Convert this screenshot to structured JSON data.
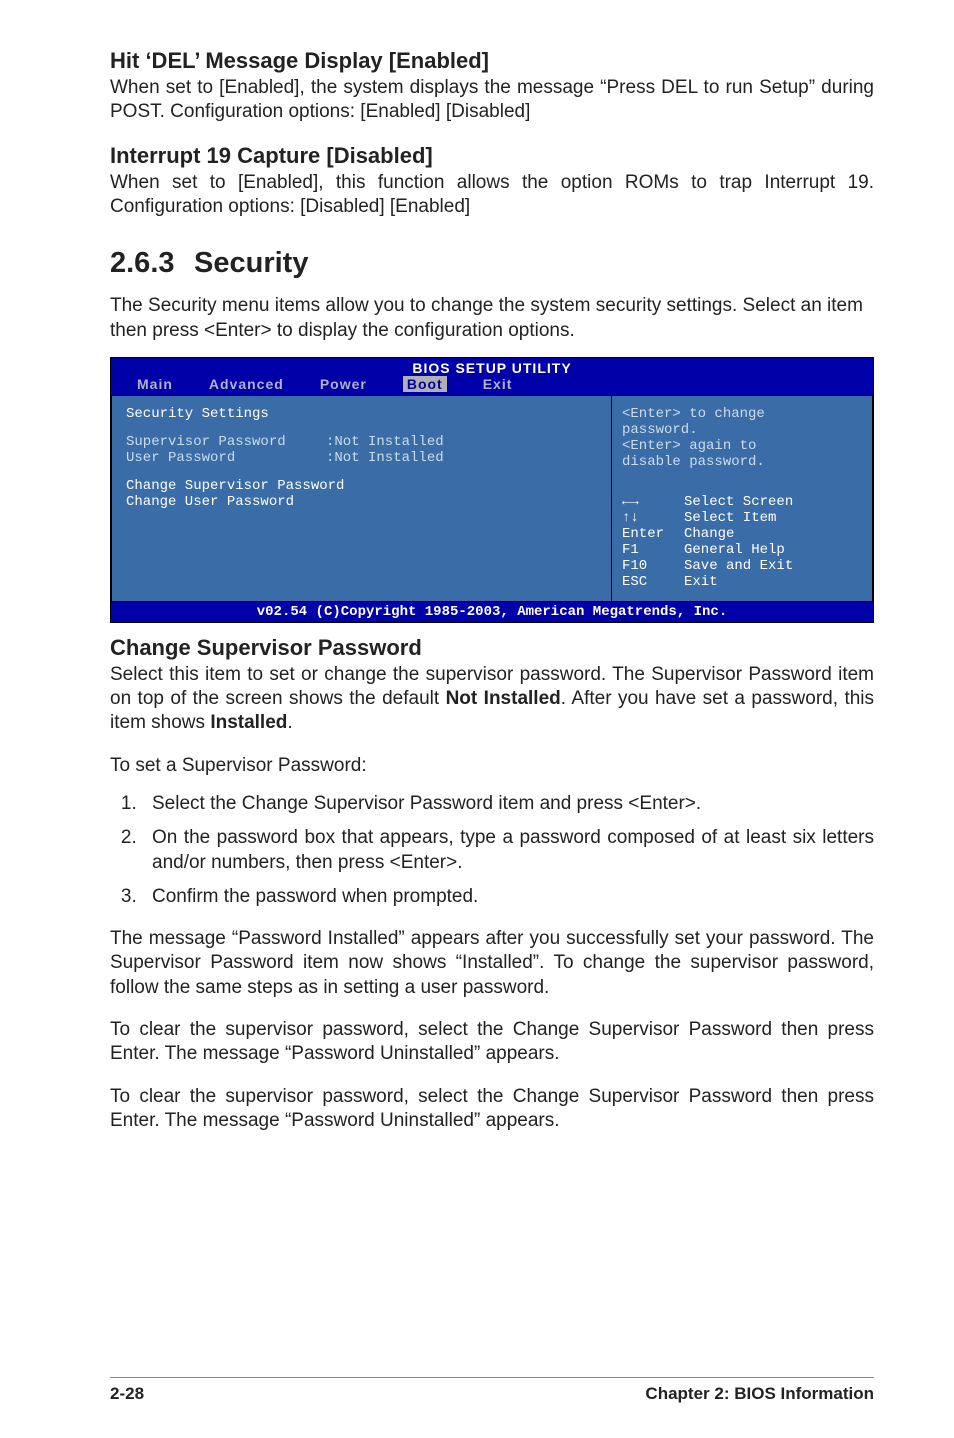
{
  "sec1": {
    "head": "Hit ‘DEL’ Message Display [Enabled]",
    "body": "When set to [Enabled], the system displays the message “Press DEL to run Setup” during POST. Configuration options: [Enabled] [Disabled]"
  },
  "sec2": {
    "head": "Interrupt 19 Capture [Disabled]",
    "body": "When set to [Enabled], this function allows the option ROMs to trap Interrupt 19. Configuration options: [Disabled] [Enabled]"
  },
  "security": {
    "num": "2.6.3",
    "title": "Security",
    "intro": "The Security menu items allow you to change the system security settings. Select an item then press <Enter> to display the configuration options."
  },
  "bios": {
    "title": "BIOS SETUP UTILITY",
    "tabs": [
      "Main",
      "Advanced",
      "Power",
      "Boot",
      "Exit"
    ],
    "active_tab_index": 3,
    "left": {
      "heading": "Security Settings",
      "rows": [
        {
          "label": "Supervisor Password",
          "value": ":Not Installed"
        },
        {
          "label": "User Password",
          "value": ":Not Installed"
        }
      ],
      "items": [
        "Change Supervisor Password",
        "Change User Password"
      ]
    },
    "right": {
      "help": [
        "<Enter> to change",
        "password.",
        "<Enter> again to",
        "disable password."
      ],
      "keys": [
        {
          "k": "←→",
          "v": "Select Screen"
        },
        {
          "k": "↑↓",
          "v": "Select Item"
        },
        {
          "k": "Enter",
          "v": "Change"
        },
        {
          "k": "F1",
          "v": "General Help"
        },
        {
          "k": "F10",
          "v": "Save and Exit"
        },
        {
          "k": "ESC",
          "v": "Exit"
        }
      ]
    },
    "foot": "v02.54 (C)Copyright 1985-2003, American Megatrends, Inc."
  },
  "changesup": {
    "head": "Change Supervisor Password",
    "p1_a": "Select this item to set or change the supervisor password. The Supervisor Password item on top of the screen shows the default ",
    "p1_b": "Not Installed",
    "p1_c": ". After you have set a password, this item shows ",
    "p1_d": "Installed",
    "p1_e": ".",
    "p2": "To set a Supervisor Password:",
    "list": [
      "Select the Change Supervisor Password item and press <Enter>.",
      "On the password box that appears, type a password composed of at least six letters and/or numbers, then press <Enter>.",
      "Confirm the password when prompted."
    ],
    "p3": "The message “Password Installed” appears after you successfully set your password. The Supervisor Password item now shows “Installed”. To change the supervisor password, follow the same steps as in setting a user password.",
    "p4": "To clear the supervisor password, select the Change Supervisor Password then press Enter. The message “Password Uninstalled” appears.",
    "p5": "To clear the supervisor password, select the Change Supervisor Password then press Enter. The message “Password Uninstalled” appears."
  },
  "footer": {
    "page": "2-28",
    "chapter": "Chapter 2: BIOS Information"
  }
}
